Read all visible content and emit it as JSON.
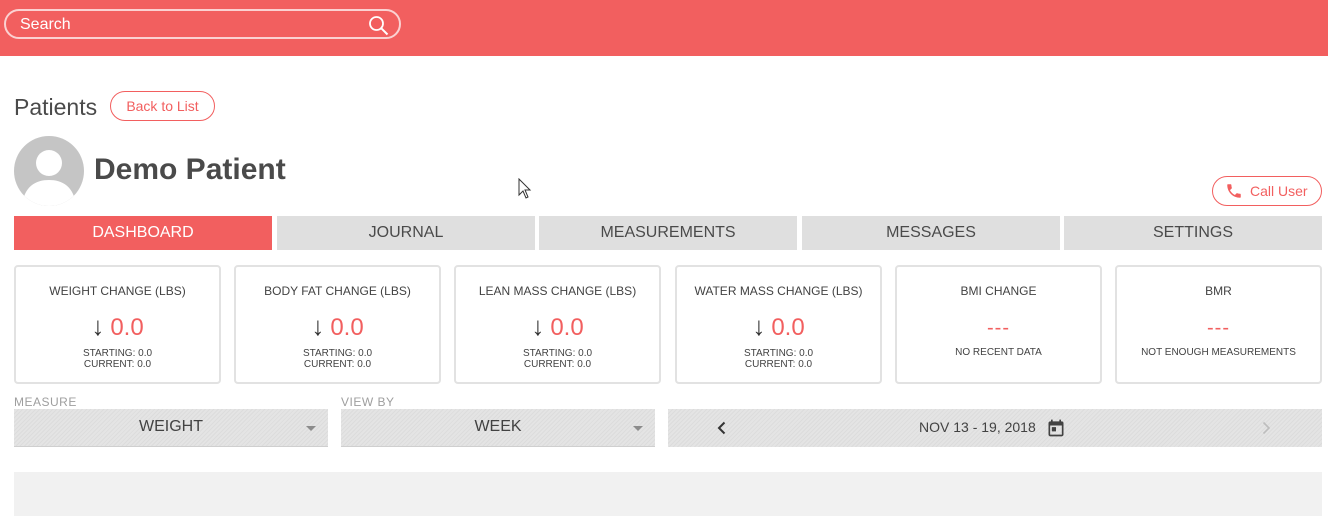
{
  "header": {
    "search_placeholder": "Search",
    "accent_color": "#f25f5f"
  },
  "breadcrumb": {
    "section": "Patients",
    "back_label": "Back to List"
  },
  "patient": {
    "name": "Demo Patient",
    "call_label": "Call User"
  },
  "tabs": [
    {
      "label": "DASHBOARD",
      "active": true
    },
    {
      "label": "JOURNAL",
      "active": false
    },
    {
      "label": "MEASUREMENTS",
      "active": false
    },
    {
      "label": "MESSAGES",
      "active": false
    },
    {
      "label": "SETTINGS",
      "active": false
    }
  ],
  "cards": [
    {
      "title": "WEIGHT CHANGE (LBS)",
      "value": "0.0",
      "starting": "STARTING: 0.0",
      "current": "CURRENT: 0.0"
    },
    {
      "title": "BODY FAT CHANGE (LBS)",
      "value": "0.0",
      "starting": "STARTING: 0.0",
      "current": "CURRENT: 0.0"
    },
    {
      "title": "LEAN MASS CHANGE (LBS)",
      "value": "0.0",
      "starting": "STARTING: 0.0",
      "current": "CURRENT: 0.0"
    },
    {
      "title": "WATER MASS CHANGE (LBS)",
      "value": "0.0",
      "starting": "STARTING: 0.0",
      "current": "CURRENT: 0.0"
    },
    {
      "title": "BMI CHANGE",
      "value": "---",
      "note": "NO RECENT DATA"
    },
    {
      "title": "BMR",
      "value": "---",
      "note": "NOT ENOUGH MEASUREMENTS"
    }
  ],
  "controls": {
    "measure_label": "MEASURE",
    "measure_value": "WEIGHT",
    "view_by_label": "VIEW BY",
    "view_by_value": "WEEK",
    "date_range": "NOV 13 - 19, 2018"
  }
}
